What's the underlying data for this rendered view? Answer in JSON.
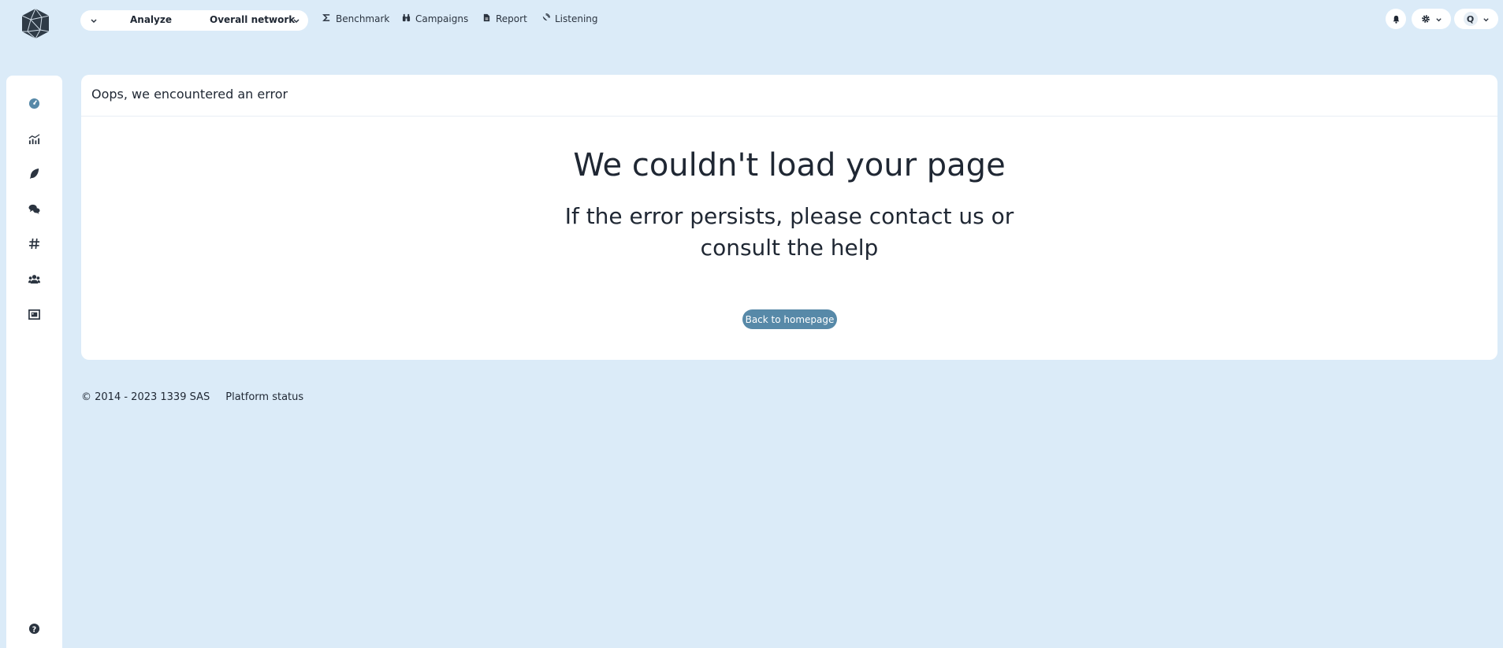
{
  "topbar": {
    "switcher": {
      "mode": "Analyze",
      "scope": "Overall network"
    },
    "nav": [
      {
        "label": "Benchmark",
        "icon": "sigma-icon"
      },
      {
        "label": "Campaigns",
        "icon": "binoculars-icon"
      },
      {
        "label": "Report",
        "icon": "file-icon"
      },
      {
        "label": "Listening",
        "icon": "satellite-dish-icon"
      }
    ],
    "user_initial": "Q"
  },
  "sidebar": {
    "items": [
      "dashboard-icon",
      "stats-icon",
      "feather-icon",
      "comments-icon",
      "hashtag-icon",
      "users-icon",
      "media-icon"
    ],
    "help": "help-icon"
  },
  "card": {
    "header": "Oops, we encountered an error",
    "title": "We couldn't load your page",
    "subtitle": "If the error persists, please contact us or consult the help",
    "button": "Back to homepage"
  },
  "footer": {
    "copyright": "© 2014 - 2023 1339 SAS",
    "status_link": "Platform status"
  },
  "colors": {
    "background": "#dbebf8",
    "accent": "#5789a8",
    "text": "#1f2733"
  }
}
